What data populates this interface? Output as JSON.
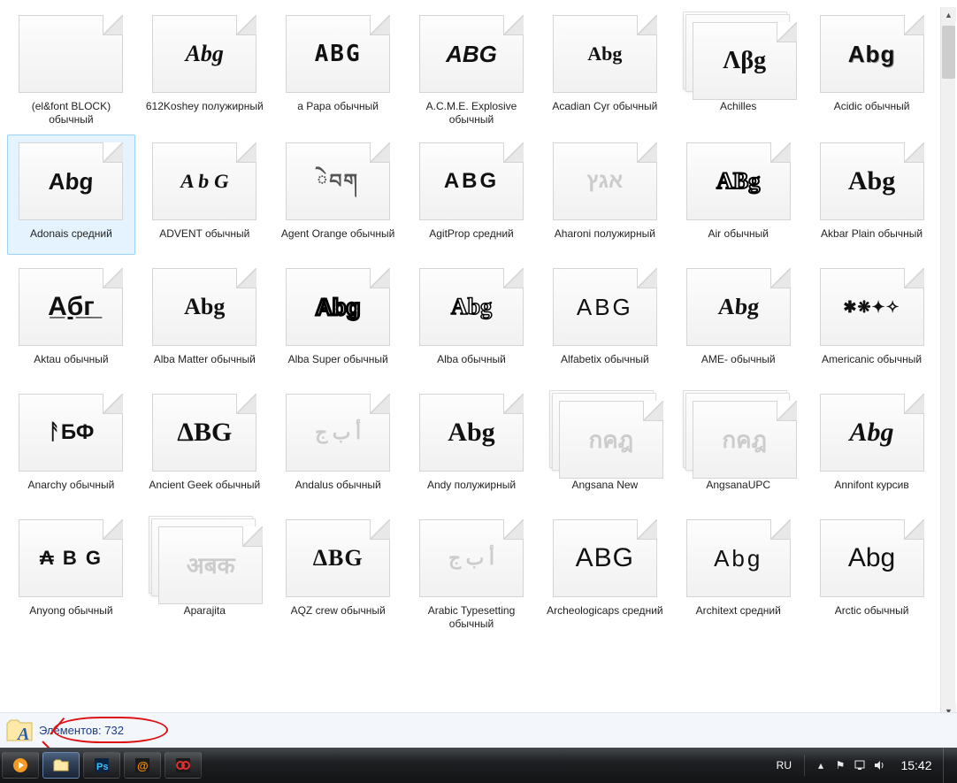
{
  "items": [
    {
      "label": "(el&font BLOCK) обычный",
      "preview": "",
      "stack": false,
      "previewStyle": "opacity:0"
    },
    {
      "label": "612Koshey полужирный",
      "preview": "Abg",
      "stack": false,
      "previewStyle": "font-style:italic;font-weight:900;font-family:cursive"
    },
    {
      "label": "a Papa обычный",
      "preview": "ABG",
      "stack": false,
      "previewStyle": "font-family:monospace;letter-spacing:2px"
    },
    {
      "label": "A.C.M.E. Explosive обычный",
      "preview": "ABG",
      "stack": false,
      "previewStyle": "font-style:italic;font-weight:800"
    },
    {
      "label": "Acadian Cyr обычный",
      "preview": "Abg",
      "stack": false,
      "previewStyle": "font-family:cursive;font-size:22px"
    },
    {
      "label": "Achilles",
      "preview": "Λβg",
      "stack": true,
      "previewStyle": "font-family:serif;font-size:28px"
    },
    {
      "label": "Acidic обычный",
      "preview": "Abg",
      "stack": false,
      "previewStyle": "font-weight:900;letter-spacing:1px;text-shadow:1px 1px 0 #999"
    },
    {
      "label": "Adonais средний",
      "preview": "Abg",
      "stack": false,
      "selected": true,
      "previewStyle": "font-weight:900;font-family:Arial Black,sans-serif;transform:skewX(-3deg)"
    },
    {
      "label": "ADVENT обычный",
      "preview": "A b G",
      "stack": false,
      "previewStyle": "font-family:fantasy;font-size:22px;transform:skewX(-8deg)"
    },
    {
      "label": "Agent Orange обычный",
      "preview": "ེབག",
      "stack": false,
      "previewStyle": "font-size:22px;opacity:0.7;letter-spacing:2px"
    },
    {
      "label": "AgitProp средний",
      "preview": "ABG",
      "stack": false,
      "previewStyle": "font-weight:900;font-family:Impact,sans-serif;letter-spacing:3px;font-size:24px"
    },
    {
      "label": "Aharoni полужирный",
      "preview": "אגץ",
      "stack": false,
      "previewStyle": "color:#ccc;font-weight:700;font-size:24px"
    },
    {
      "label": "Air обычный",
      "preview": "ABg",
      "stack": false,
      "previewStyle": "font-weight:900;font-family:Impact;-webkit-text-stroke:2px #000;color:#fff"
    },
    {
      "label": "Akbar Plain обычный",
      "preview": "Abg",
      "stack": false,
      "previewStyle": "font-family:Comic Sans MS,cursive;font-size:30px"
    },
    {
      "label": "Aktau обычный",
      "preview": "A̲б̲г̲",
      "stack": false,
      "previewStyle": "font-weight:900;font-size:30px;text-decoration:underline"
    },
    {
      "label": "Alba Matter обычный",
      "preview": "Abg",
      "stack": false,
      "previewStyle": "font-weight:900;font-family:Arial Rounded MT Bold,Arial Black"
    },
    {
      "label": "Alba Super обычный",
      "preview": "Abg",
      "stack": false,
      "previewStyle": "font-weight:900;-webkit-text-stroke:3px #000;color:#fff"
    },
    {
      "label": "Alba обычный",
      "preview": "Abg",
      "stack": false,
      "previewStyle": "font-weight:900;font-family:Arial Rounded MT Bold,Arial Black;-webkit-text-stroke:1.5px #000;color:#fff"
    },
    {
      "label": "Alfabetix обычный",
      "preview": "ABG",
      "stack": false,
      "previewStyle": "font-family:Optima,sans-serif;font-weight:400;letter-spacing:3px"
    },
    {
      "label": "AME- обычный",
      "preview": "Abg",
      "stack": false,
      "previewStyle": "font-family:cursive;font-weight:700;transform:skewX(-5deg)"
    },
    {
      "label": "Americanic обычный",
      "preview": "✱❋✦✧",
      "stack": false,
      "previewStyle": "font-size:18px;letter-spacing:1px"
    },
    {
      "label": "Anarchy обычный",
      "preview": "ᚨБФ",
      "stack": false,
      "previewStyle": "font-weight:900;font-size:24px"
    },
    {
      "label": "Ancient Geek обычный",
      "preview": "ΔBG",
      "stack": false,
      "previewStyle": "font-family:serif;font-size:30px"
    },
    {
      "label": "Andalus обычный",
      "preview": "أ ب ج",
      "stack": false,
      "previewStyle": "color:#ccc;font-family:serif;font-size:22px;direction:rtl"
    },
    {
      "label": "Andy полужирный",
      "preview": "Abg",
      "stack": false,
      "previewStyle": "font-family:Comic Sans MS,cursive;font-weight:700;font-size:30px"
    },
    {
      "label": "Angsana New",
      "preview": "กคฎ",
      "stack": true,
      "previewStyle": "color:#ccc;font-size:26px"
    },
    {
      "label": "AngsanaUPC",
      "preview": "กคฎ",
      "stack": true,
      "previewStyle": "color:#ccc;font-size:26px"
    },
    {
      "label": "Annifont курсив",
      "preview": "Abg",
      "stack": false,
      "previewStyle": "font-style:italic;font-family:cursive;font-size:30px"
    },
    {
      "label": "Anyong обычный",
      "preview": "₳ B G",
      "stack": false,
      "previewStyle": "font-weight:700;font-size:22px;letter-spacing:2px"
    },
    {
      "label": "Aparajita",
      "preview": "अबक",
      "stack": true,
      "previewStyle": "color:#ccc;font-size:26px"
    },
    {
      "label": "AQZ crew обычный",
      "preview": "ΔBG",
      "stack": false,
      "previewStyle": "font-weight:900;font-family:Arial Black;letter-spacing:1px"
    },
    {
      "label": "Arabic Typesetting обычный",
      "preview": "أ ب ج",
      "stack": false,
      "previewStyle": "color:#ccc;font-family:serif;font-size:22px;direction:rtl"
    },
    {
      "label": "Archeologicaps средний",
      "preview": "ABG",
      "stack": false,
      "previewStyle": "font-weight:300;font-family:Optima,sans-serif;font-size:30px;letter-spacing:1px"
    },
    {
      "label": "Architext средний",
      "preview": "Abg",
      "stack": false,
      "previewStyle": "font-weight:300;letter-spacing:3px;font-family:Century Gothic,sans-serif"
    },
    {
      "label": "Arctic обычный",
      "preview": "Abg",
      "stack": false,
      "previewStyle": "font-weight:300;font-family:Century Gothic,sans-serif;font-size:30px"
    }
  ],
  "status": {
    "label": "Элементов: 732"
  },
  "taskbar": {
    "lang": "RU",
    "time": "15:42"
  }
}
